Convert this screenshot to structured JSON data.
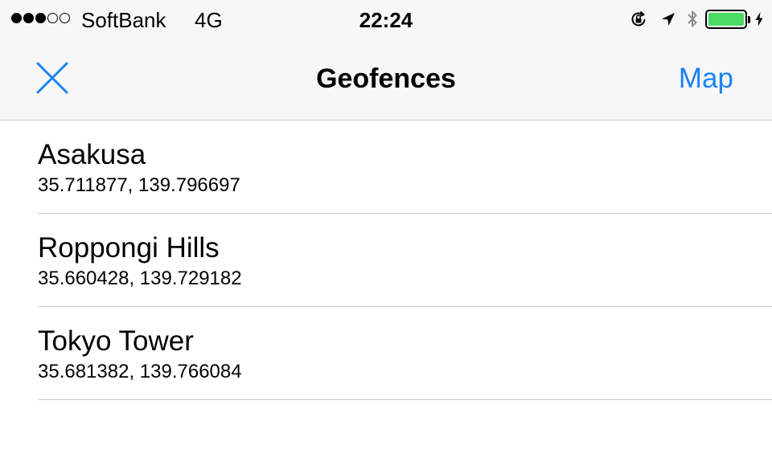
{
  "status_bar": {
    "signal_bars_filled": 3,
    "signal_bars_total": 5,
    "carrier": "SoftBank",
    "network": "4G",
    "time": "22:24",
    "icons": [
      "orientation-lock-icon",
      "location-arrow-icon",
      "bluetooth-icon",
      "battery-icon",
      "charging-bolt-icon"
    ],
    "battery_level": 1.0,
    "battery_color": "#4cd964"
  },
  "nav": {
    "close_icon": "close-icon",
    "title": "Geofences",
    "map_label": "Map",
    "accent_color": "#1a82fb"
  },
  "geofences": [
    {
      "name": "Asakusa",
      "coords": "35.711877, 139.796697"
    },
    {
      "name": "Roppongi Hills",
      "coords": "35.660428, 139.729182"
    },
    {
      "name": "Tokyo Tower",
      "coords": "35.681382, 139.766084"
    }
  ]
}
